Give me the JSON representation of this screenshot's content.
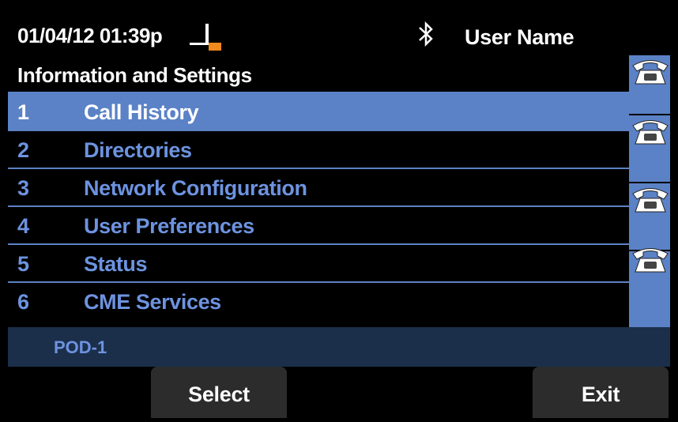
{
  "header": {
    "datetime": "01/04/12 01:39p",
    "user_name": "User Name",
    "icons": [
      "offhook-icon",
      "bluetooth-icon"
    ]
  },
  "menu": {
    "title": "Information and Settings",
    "selected_index": 0,
    "items": [
      {
        "num": "1",
        "label": "Call History"
      },
      {
        "num": "2",
        "label": "Directories"
      },
      {
        "num": "3",
        "label": "Network Configuration"
      },
      {
        "num": "4",
        "label": "User Preferences"
      },
      {
        "num": "5",
        "label": "Status"
      },
      {
        "num": "6",
        "label": "CME Services"
      }
    ]
  },
  "line_keys": {
    "icons": [
      "phone-icon",
      "phone-icon",
      "phone-icon",
      "phone-icon"
    ]
  },
  "status_line": "POD-1",
  "softkeys": {
    "select": "Select",
    "exit": "Exit"
  },
  "colors": {
    "accent": "#5b82c6",
    "item_text": "#6d93e0",
    "footer_bar": "#1b2f4b",
    "softkey_bg": "#2c2c2c",
    "offhook_orange": "#f08a1c"
  }
}
